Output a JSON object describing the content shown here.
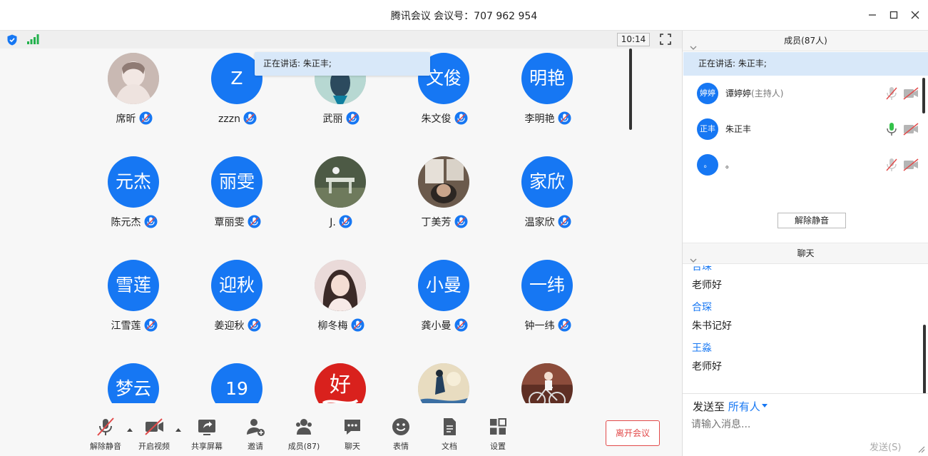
{
  "window": {
    "title": "腾讯会议 会议号：707 962 954"
  },
  "meeting": {
    "clock": "10:14",
    "speaking_toast": "正在讲话: 朱正丰;",
    "participants": [
      {
        "name": "席昕",
        "avatar_text": "",
        "photo": "photo-person-light"
      },
      {
        "name": "zzzn",
        "avatar_text": "Z",
        "photo": ""
      },
      {
        "name": "武丽",
        "avatar_text": "",
        "photo": "photo-teal-figure"
      },
      {
        "name": "朱文俊",
        "avatar_text": "文俊",
        "photo": ""
      },
      {
        "name": "李明艳",
        "avatar_text": "明艳",
        "photo": ""
      },
      {
        "name": "陈元杰",
        "avatar_text": "元杰",
        "photo": ""
      },
      {
        "name": "覃丽雯",
        "avatar_text": "丽雯",
        "photo": ""
      },
      {
        "name": "J.",
        "avatar_text": "",
        "photo": "photo-dark-table"
      },
      {
        "name": "丁美芳",
        "avatar_text": "",
        "photo": "photo-selfie"
      },
      {
        "name": "温家欣",
        "avatar_text": "家欣",
        "photo": ""
      },
      {
        "name": "江雪莲",
        "avatar_text": "雪莲",
        "photo": ""
      },
      {
        "name": "姜迎秋",
        "avatar_text": "迎秋",
        "photo": ""
      },
      {
        "name": "柳冬梅",
        "avatar_text": "",
        "photo": "photo-girl"
      },
      {
        "name": "龚小曼",
        "avatar_text": "小曼",
        "photo": ""
      },
      {
        "name": "钟一纬",
        "avatar_text": "一纬",
        "photo": ""
      },
      {
        "name": "",
        "avatar_text": "梦云",
        "photo": ""
      },
      {
        "name": "",
        "avatar_text": "19",
        "photo": ""
      },
      {
        "name": "",
        "avatar_text": "好",
        "photo": "photo-red-poster"
      },
      {
        "name": "",
        "avatar_text": "",
        "photo": "photo-illustration"
      },
      {
        "name": "",
        "avatar_text": "",
        "photo": "photo-bike"
      }
    ]
  },
  "toolbar": {
    "unmute": "解除静音",
    "start_video": "开启视频",
    "share_screen": "共享屏幕",
    "invite": "邀请",
    "members": "成员(87)",
    "chat": "聊天",
    "emoji": "表情",
    "docs": "文档",
    "settings": "设置",
    "leave": "离开会议"
  },
  "members_panel": {
    "header": "成员(87人)",
    "speaking": "正在讲话: 朱正丰;",
    "members": [
      {
        "avatar_text": "婷婷",
        "name": "谭婷婷",
        "role": "(主持人)",
        "mic": "muted",
        "cam": "off"
      },
      {
        "avatar_text": "正丰",
        "name": "朱正丰",
        "role": "",
        "mic": "active",
        "cam": "off"
      },
      {
        "avatar_text": "。",
        "name": "。",
        "role": "",
        "mic": "muted",
        "cam": "off"
      }
    ],
    "unmute_all": "解除静音"
  },
  "chat_panel": {
    "header": "聊天",
    "messages": [
      {
        "sender": "合琛",
        "text": "老师好"
      },
      {
        "sender": "合琛",
        "text": "朱书记好"
      },
      {
        "sender": "王淼",
        "text": "老师好"
      }
    ],
    "send_to_label": "发送至",
    "send_to_target": "所有人",
    "input_placeholder": "请输入消息...",
    "send_button": "发送(S)"
  },
  "colors": {
    "accent": "#1677f3",
    "speaking_bg": "#d8e8f9",
    "leave_red": "#e24a4a"
  }
}
